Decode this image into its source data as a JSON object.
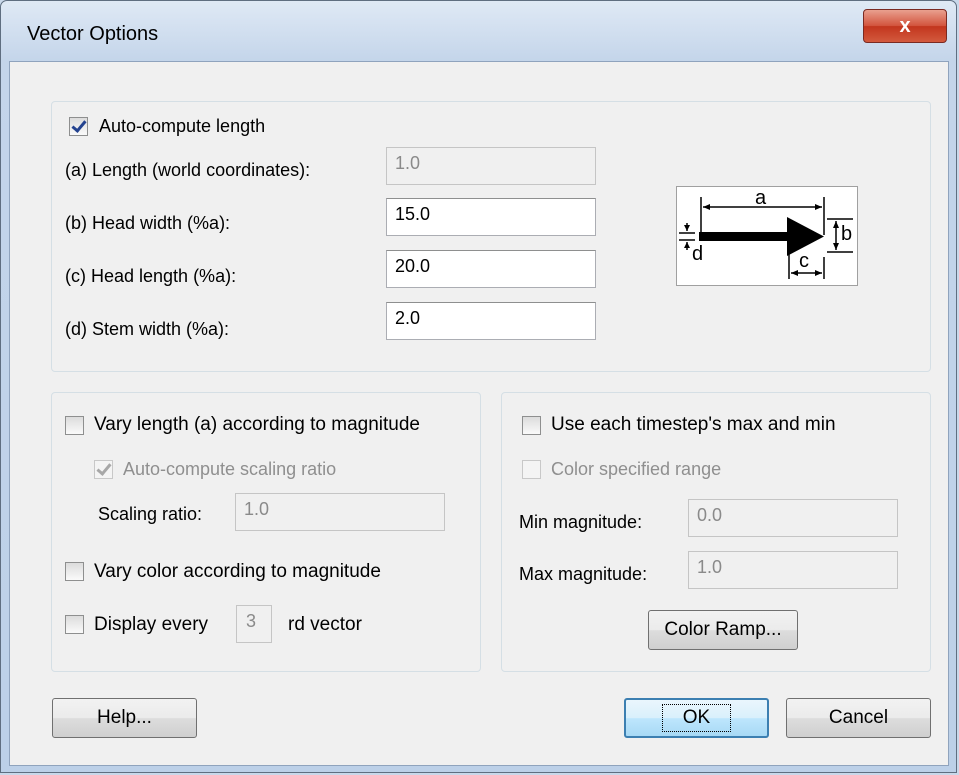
{
  "window": {
    "title": "Vector Options",
    "close_glyph": "x"
  },
  "length_group": {
    "auto_compute_label": "Auto-compute length",
    "auto_compute_checked": true,
    "length_label": "(a) Length (world coordinates):",
    "length_value": "1.0",
    "head_width_label": "(b) Head width (%a):",
    "head_width_value": "15.0",
    "head_length_label": "(c) Head length (%a):",
    "head_length_value": "20.0",
    "stem_width_label": "(d) Stem width (%a):",
    "stem_width_value": "2.0",
    "diagram": {
      "a": "a",
      "b": "b",
      "c": "c",
      "d": "d"
    }
  },
  "magnitude_group": {
    "vary_length_label": "Vary length (a) according to magnitude",
    "vary_length_checked": false,
    "auto_scaling_label": "Auto-compute scaling ratio",
    "auto_scaling_checked": true,
    "scaling_ratio_label": "Scaling ratio:",
    "scaling_ratio_value": "1.0",
    "vary_color_label": "Vary color according to magnitude",
    "vary_color_checked": false,
    "display_every_label": "Display every",
    "display_every_value": "3",
    "display_every_suffix": "rd vector",
    "display_every_checked": false
  },
  "range_group": {
    "use_timestep_label": "Use each timestep's max and min",
    "use_timestep_checked": false,
    "color_range_label": "Color specified range",
    "color_range_checked": false,
    "min_label": "Min magnitude:",
    "min_value": "0.0",
    "max_label": "Max magnitude:",
    "max_value": "1.0",
    "color_ramp_label": "Color Ramp..."
  },
  "footer": {
    "help_label": "Help...",
    "ok_label": "OK",
    "cancel_label": "Cancel"
  }
}
